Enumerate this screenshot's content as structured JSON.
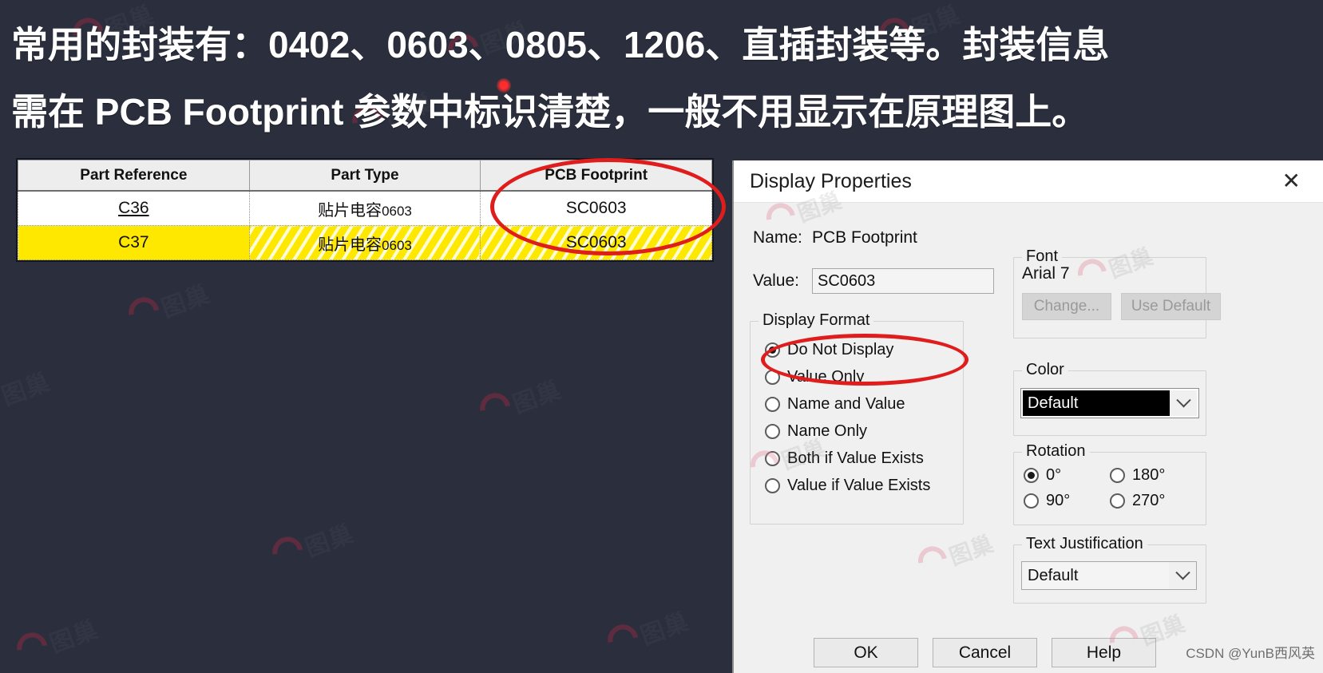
{
  "header": {
    "line1": "常用的封装有：0402、0603、0805、1206、直插封装等。封装信息",
    "line2": "需在 PCB Footprint 参数中标识清楚，一般不用显示在原理图上。"
  },
  "parts_table": {
    "columns": [
      "Part Reference",
      "Part Type",
      "PCB Footprint"
    ],
    "rows": [
      {
        "part_reference": "C36",
        "part_type_cn": "贴片电容",
        "part_type_size": "0603",
        "pcb_footprint": "SC0603",
        "selected": false
      },
      {
        "part_reference": "C37",
        "part_type_cn": "贴片电容",
        "part_type_size": "0603",
        "pcb_footprint": "SC0603",
        "selected": true
      }
    ]
  },
  "dialog": {
    "title": "Display Properties",
    "close_icon": "close-icon",
    "name_label": "Name:",
    "name_value": "PCB Footprint",
    "value_label": "Value:",
    "value_input": "SC0603",
    "display_format": {
      "legend": "Display Format",
      "options": [
        {
          "label": "Do Not Display",
          "selected": true
        },
        {
          "label": "Value Only",
          "selected": false
        },
        {
          "label": "Name and Value",
          "selected": false
        },
        {
          "label": "Name Only",
          "selected": false
        },
        {
          "label": "Both if Value Exists",
          "selected": false
        },
        {
          "label": "Value if Value Exists",
          "selected": false
        }
      ]
    },
    "font": {
      "legend": "Font",
      "name": "Arial 7",
      "change_button": "Change...",
      "use_default_button": "Use Default"
    },
    "color": {
      "legend": "Color",
      "selected": "Default",
      "swatch_hex": "#000000"
    },
    "rotation": {
      "legend": "Rotation",
      "options": [
        {
          "label": "0°",
          "selected": true
        },
        {
          "label": "180°",
          "selected": false
        },
        {
          "label": "90°",
          "selected": false
        },
        {
          "label": "270°",
          "selected": false
        }
      ]
    },
    "justification": {
      "legend": "Text Justification",
      "selected": "Default"
    },
    "buttons": {
      "ok": "OK",
      "cancel": "Cancel",
      "help": "Help"
    }
  },
  "watermark": {
    "site": "图巢",
    "csdn": "CSDN @YunB西风英"
  },
  "colors": {
    "background": "#2b2f3d",
    "highlight_row": "#ffe800",
    "annotation_red": "#e01d1d",
    "dialog_bg": "#f0f0f0"
  }
}
